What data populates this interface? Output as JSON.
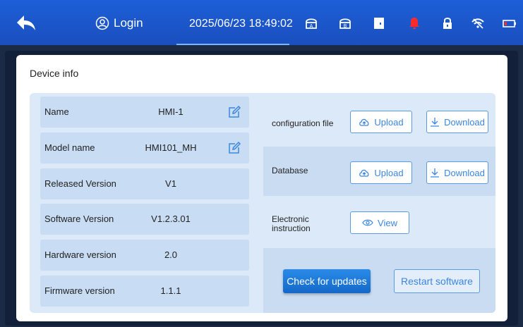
{
  "topbar": {
    "login_label": "Login",
    "datetime": "2025/06/23 18:49:02",
    "icons": [
      "back-arrow-icon",
      "user-icon",
      "printer-a-icon",
      "printer-b-icon",
      "door-icon",
      "alarm-bell-icon",
      "lock-icon",
      "wifi-off-icon",
      "battery-icon"
    ],
    "colors": {
      "bar": "#1d5fd6",
      "alarm": "#ff2a2a"
    }
  },
  "page": {
    "title": "Device info"
  },
  "device": {
    "rows": [
      {
        "label": "Name",
        "value": "HMI-1",
        "editable": true
      },
      {
        "label": "Model name",
        "value": "HMI101_MH",
        "editable": true
      },
      {
        "label": "Released Version",
        "value": "V1",
        "editable": false
      },
      {
        "label": "Software Version",
        "value": "V1.2.3.01",
        "editable": false
      },
      {
        "label": "Hardware version",
        "value": "2.0",
        "editable": false
      },
      {
        "label": "Firmware version",
        "value": "1.1.1",
        "editable": false
      }
    ]
  },
  "actions": {
    "config": {
      "label": "configuration file",
      "upload": "Upload",
      "download": "Download"
    },
    "database": {
      "label": "Database",
      "upload": "Upload",
      "download": "Download"
    },
    "manual": {
      "label_line1": "Electronic",
      "label_line2": "instruction",
      "view": "View"
    },
    "check_updates": "Check for updates",
    "restart": "Restart software"
  },
  "colors": {
    "accent": "#3a86e0",
    "panel": "#dce9f8",
    "row": "#c8dcf3"
  }
}
